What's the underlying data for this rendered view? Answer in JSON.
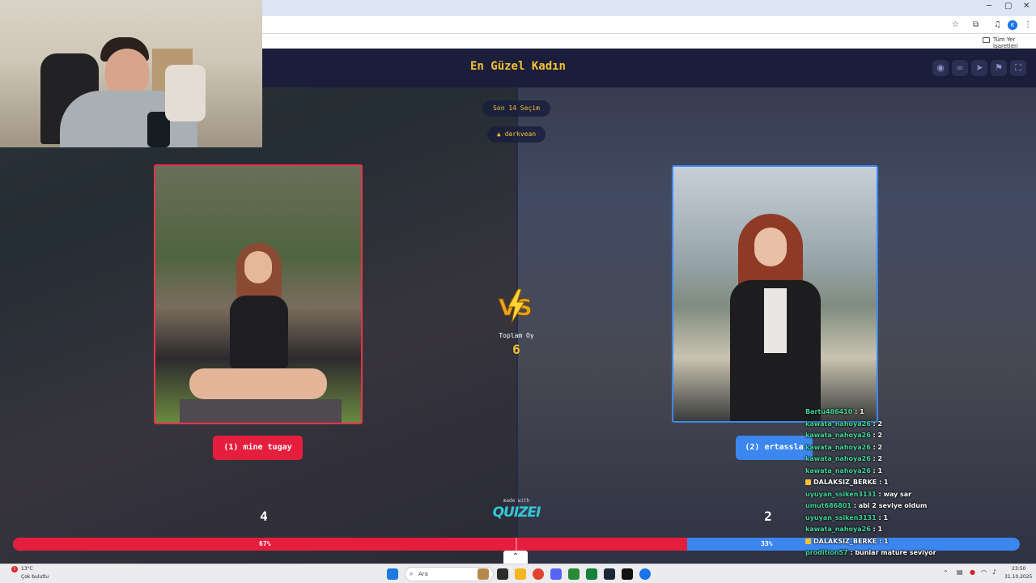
{
  "browser": {
    "bookmarks_label": "Tüm Yer İşaretleri",
    "profile_initial": "K",
    "window_controls": [
      "─",
      "▢",
      "✕"
    ]
  },
  "app": {
    "title": "En Güzel Kadın",
    "round_pill": "Son 14 Seçim",
    "creator": "darkvean",
    "header_icons": [
      "eye-icon",
      "link-icon",
      "send-icon",
      "flag-icon",
      "fullscreen-icon"
    ],
    "total_label": "Toplam Oy",
    "total_value": "6",
    "left": {
      "button": "(1) mine tugay",
      "score": "4",
      "percent": "67%",
      "share": 0.67,
      "color": "#e51e3d"
    },
    "right": {
      "button": "(2) ertassla",
      "score": "2",
      "percent": "33%",
      "share": 0.33,
      "color": "#3c86f0"
    },
    "made_with": "made with",
    "logo_text": "QUIZEI"
  },
  "chat": [
    {
      "user": "Bartu486410",
      "msg": "1"
    },
    {
      "user": "kawata_nahoya26",
      "msg": "2"
    },
    {
      "user": "kawata_nahoya26",
      "msg": "2"
    },
    {
      "user": "kawata_nahoya26",
      "msg": "2"
    },
    {
      "user": "kawata_nahoya26",
      "msg": "2"
    },
    {
      "user": "kawata_nahoya26",
      "msg": "1"
    },
    {
      "user": "DALAKSIZ_BERKE",
      "msg": "1",
      "badge": true
    },
    {
      "user": "uyuyan_ssiken3131",
      "msg": "way sar"
    },
    {
      "user": "umut686801",
      "msg": "abi 2 seviye oldum"
    },
    {
      "user": "uyuyan_ssiken3131",
      "msg": "1"
    },
    {
      "user": "kawata_nahoya26",
      "msg": "1"
    },
    {
      "user": "DALAKSIZ_BERKE",
      "msg": "1",
      "badge": true
    },
    {
      "user": "prodition57",
      "msg": "bunlar mature seviyor"
    }
  ],
  "taskbar": {
    "weather_temp": "13°C",
    "weather_desc": "Çok bulutlu",
    "weather_badge": "1",
    "search_placeholder": "Ara",
    "time": "23:50",
    "date": "31.10.2025"
  },
  "colors": {
    "accent_yellow": "#f5c232",
    "red": "#e51e3d",
    "blue": "#3c86f0",
    "header": "#1b1e3a"
  }
}
